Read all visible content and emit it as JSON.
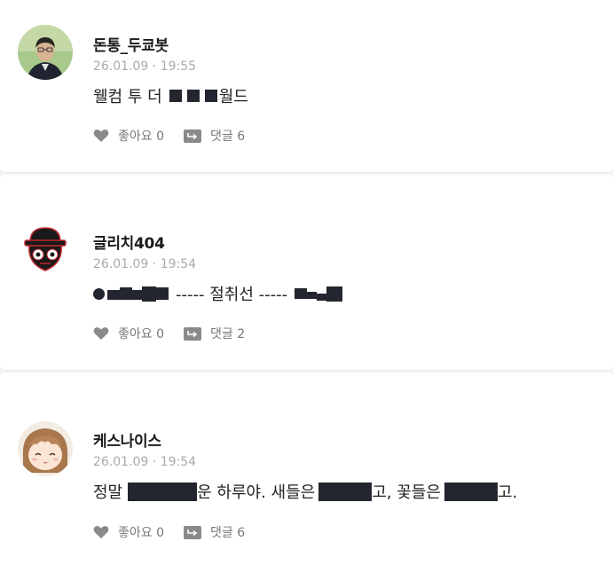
{
  "posts": [
    {
      "author": "돈통_두쿄봇",
      "timestamp": "26.01.09 · 19:55",
      "content_text_1": "웰컴 투 더",
      "content_text_2": "월드",
      "likes_label": "좋아요 0",
      "comments_label": "댓글 6"
    },
    {
      "author": "글리치404",
      "timestamp": "26.01.09 · 19:54",
      "content_text_1": "----- 절취선 -----",
      "likes_label": "좋아요 0",
      "comments_label": "댓글 2"
    },
    {
      "author": "케스나이스",
      "timestamp": "26.01.09 · 19:54",
      "content_text_1": "정말",
      "content_text_2": "운 하루야. 새들은",
      "content_text_3": "고, 꽃들은",
      "content_text_4": "고.",
      "likes_label": "좋아요 0",
      "comments_label": "댓글 6"
    }
  ],
  "icons": {
    "like": "heart-icon",
    "comment": "reply-arrow-icon"
  },
  "colors": {
    "redaction": "#23262e",
    "meta_gray": "#aaaaaa",
    "action_gray": "#777777"
  }
}
